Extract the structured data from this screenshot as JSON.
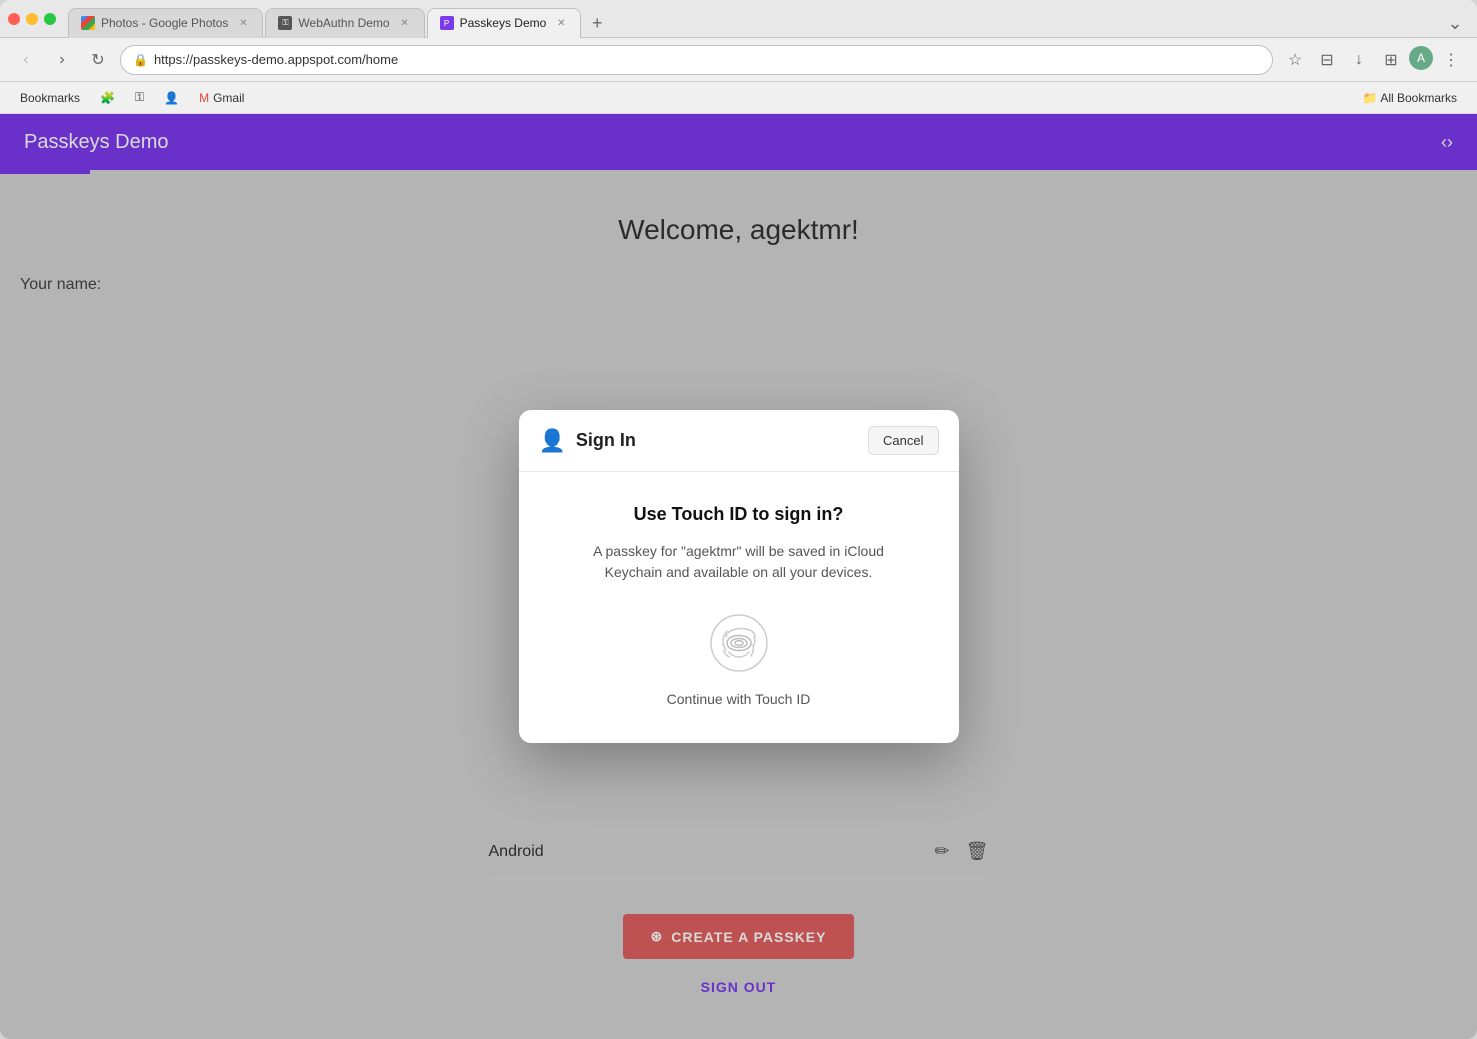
{
  "browser": {
    "tabs": [
      {
        "id": "photos",
        "label": "Photos - Google Photos",
        "favicon_type": "photos",
        "active": false
      },
      {
        "id": "webauthn",
        "label": "WebAuthn Demo",
        "favicon_type": "webauthn",
        "active": false
      },
      {
        "id": "passkeys",
        "label": "Passkeys Demo",
        "favicon_type": "passkeys",
        "active": true
      }
    ],
    "add_tab_label": "+",
    "overflow_label": "›",
    "nav": {
      "back_label": "‹",
      "forward_label": "›",
      "reload_label": "↻",
      "url": "https://passkeys-demo.appspot.com/home"
    },
    "bookmarks": [
      {
        "id": "bookmarks-label",
        "label": "Bookmarks"
      },
      {
        "id": "puzzlepiece",
        "label": ""
      },
      {
        "id": "key",
        "label": ""
      },
      {
        "id": "person",
        "label": ""
      },
      {
        "id": "gmail",
        "label": "Gmail"
      }
    ],
    "bookmarks_right": "All Bookmarks"
  },
  "app": {
    "header_title": "Passkeys Demo",
    "header_code_icon": "‹›"
  },
  "page": {
    "welcome_title": "Welcome, agektmr!",
    "your_name_label": "Your name:",
    "device_row": {
      "name": "Android",
      "edit_icon": "✏",
      "delete_icon": "🗑"
    },
    "create_passkey_btn": "CREATE A PASSKEY",
    "sign_out_link": "SIGN OUT"
  },
  "modal": {
    "title": "Sign In",
    "cancel_label": "Cancel",
    "question": "Use Touch ID to sign in?",
    "description": "A passkey for \"agektmr\" will be saved in iCloud Keychain and available on all your devices.",
    "touch_id_label": "Continue with Touch ID"
  }
}
